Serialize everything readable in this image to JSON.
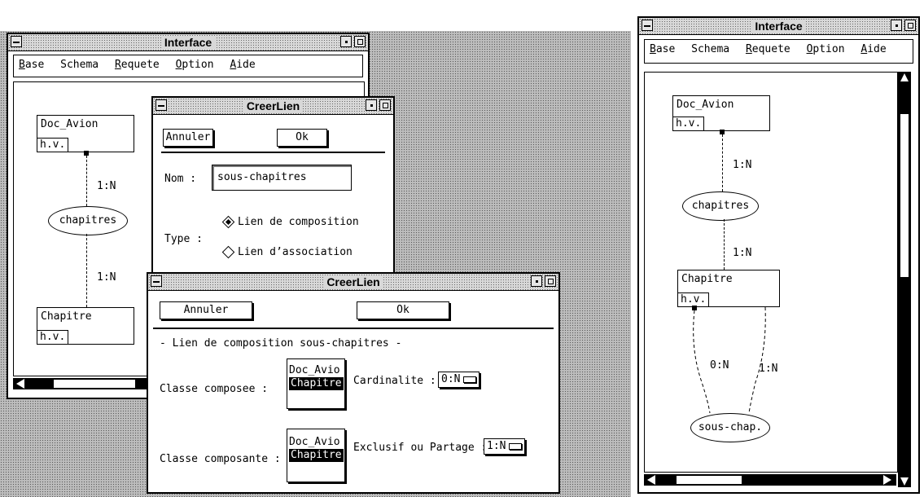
{
  "left_interface": {
    "title": "Interface",
    "menu": [
      {
        "key": "B",
        "rest": "ase"
      },
      {
        "key": "",
        "rest": "Schema"
      },
      {
        "key": "R",
        "rest": "equete"
      },
      {
        "key": "O",
        "rest": "ption"
      },
      {
        "key": "A",
        "rest": "ide"
      }
    ],
    "diagram": {
      "box1_name": "Doc_Avion",
      "box1_tag": "h.v.",
      "card1": "1:N",
      "ellipse": "chapitres",
      "card2": "1:N",
      "box2_name": "Chapitre",
      "box2_tag": "h.v."
    }
  },
  "dialog1": {
    "title": "CreerLien",
    "cancel": "Annuler",
    "ok": "Ok",
    "nom_label": "Nom :",
    "nom_value": "sous-chapitres",
    "type_label": "Type :",
    "option1": "Lien de composition",
    "option2": "Lien d’association"
  },
  "dialog2": {
    "title": "CreerLien",
    "cancel": "Annuler",
    "ok": "Ok",
    "heading": "- Lien de composition sous-chapitres -",
    "composee_label": "Classe composee :",
    "composee_items": [
      "Doc_Avio",
      "Chapitre"
    ],
    "cardinalite_label": "Cardinalite :",
    "cardinalite_value": "0:N",
    "composante_label": "Classe composante :",
    "composante_items": [
      "Doc_Avio",
      "Chapitre"
    ],
    "exclusif_label": "Exclusif ou Partage :",
    "exclusif_value": "1:N"
  },
  "right_interface": {
    "title": "Interface",
    "menu": [
      {
        "key": "B",
        "rest": "ase"
      },
      {
        "key": "",
        "rest": "Schema"
      },
      {
        "key": "R",
        "rest": "equete"
      },
      {
        "key": "O",
        "rest": "ption"
      },
      {
        "key": "A",
        "rest": "ide"
      }
    ],
    "diagram": {
      "box1_name": "Doc_Avion",
      "box1_tag": "h.v.",
      "card1": "1:N",
      "ellipse1": "chapitres",
      "card2": "1:N",
      "box2_name": "Chapitre",
      "box2_tag": "h.v.",
      "card3": "0:N",
      "card4": "1:N",
      "ellipse2": "sous-chap."
    }
  }
}
